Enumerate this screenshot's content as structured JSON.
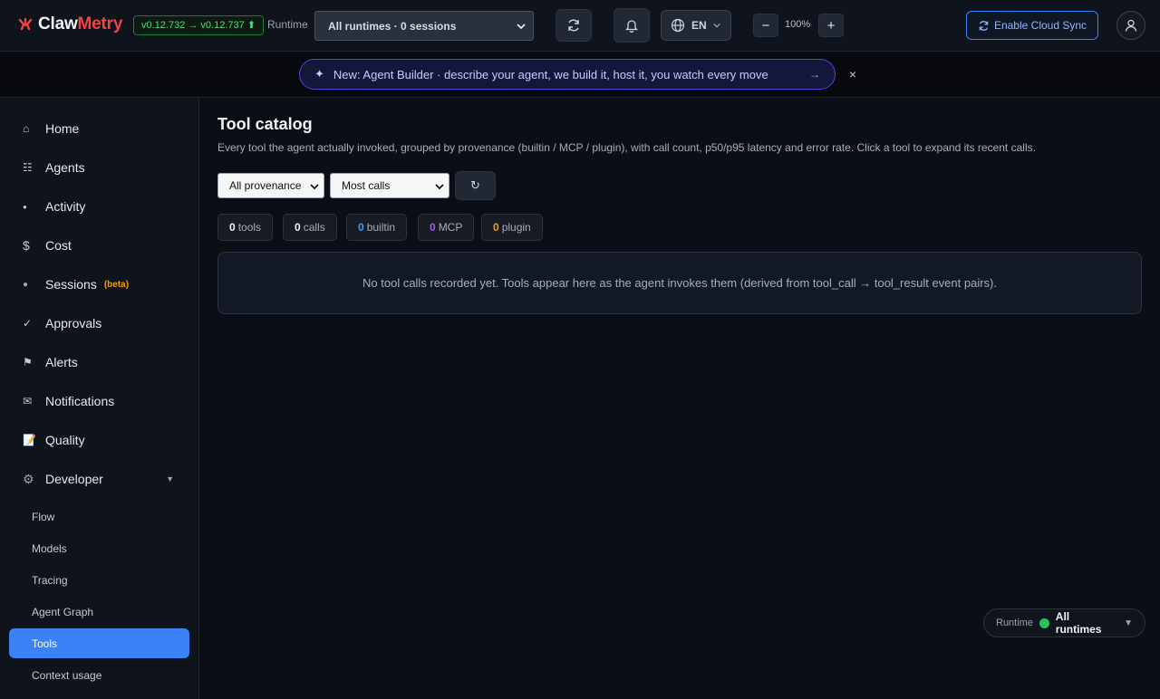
{
  "header": {
    "logo_part1": "Claw",
    "logo_part2": "Metry",
    "version": "v0.12.732 → v0.12.737 ⬆",
    "runtime_label": "Runtime",
    "runtime_select": "All runtimes · 0 sessions",
    "language": "EN",
    "zoom": "100%",
    "zoom_out": "−",
    "zoom_in": "+",
    "cloud_sync": "Enable Cloud Sync"
  },
  "banner": {
    "icon": "✦",
    "text": "New: Agent Builder · describe your agent, we build it, host it, you watch every move",
    "arrow": "→",
    "close": "×"
  },
  "sidebar": {
    "items": [
      {
        "icon": "⌂",
        "label": "Home"
      },
      {
        "icon": "☷",
        "label": "Agents"
      },
      {
        "icon": "●",
        "label": "Activity"
      },
      {
        "icon": "$",
        "label": "Cost"
      },
      {
        "icon": "●",
        "label": "Sessions",
        "badge": "(beta)"
      },
      {
        "icon": "✓",
        "label": "Approvals"
      },
      {
        "icon": "⚑",
        "label": "Alerts"
      },
      {
        "icon": "✉",
        "label": "Notifications"
      },
      {
        "icon": "📝",
        "label": "Quality"
      },
      {
        "icon": "⚙",
        "label": "Developer",
        "caret": "▼"
      }
    ],
    "subitems": [
      "Flow",
      "Models",
      "Tracing",
      "Agent Graph",
      "Tools",
      "Context usage"
    ],
    "active_subitem": "Tools"
  },
  "main": {
    "title": "Tool catalog",
    "description": "Every tool the agent actually invoked, grouped by provenance (builtin / MCP / plugin), with call count, p50/p95 latency and error rate. Click a tool to expand its recent calls.",
    "provenance_filter": "All provenance",
    "sort_filter": "Most calls",
    "refresh": "↻",
    "stats": [
      {
        "count": "0",
        "label": "tools",
        "color": "#f1f3f7"
      },
      {
        "count": "0",
        "label": "calls",
        "color": "#f1f3f7"
      },
      {
        "count": "0",
        "label": "builtin",
        "color": "#3b9cf0"
      },
      {
        "count": "0",
        "label": "MCP",
        "color": "#a855f7"
      },
      {
        "count": "0",
        "label": "plugin",
        "color": "#f59e0b"
      }
    ],
    "empty_message": "No tool calls recorded yet. Tools appear here as the agent invokes them (derived from tool_call → tool_result event pairs)."
  },
  "runtime_pill": {
    "label": "Runtime",
    "value": "All runtimes",
    "caret": "▼"
  }
}
